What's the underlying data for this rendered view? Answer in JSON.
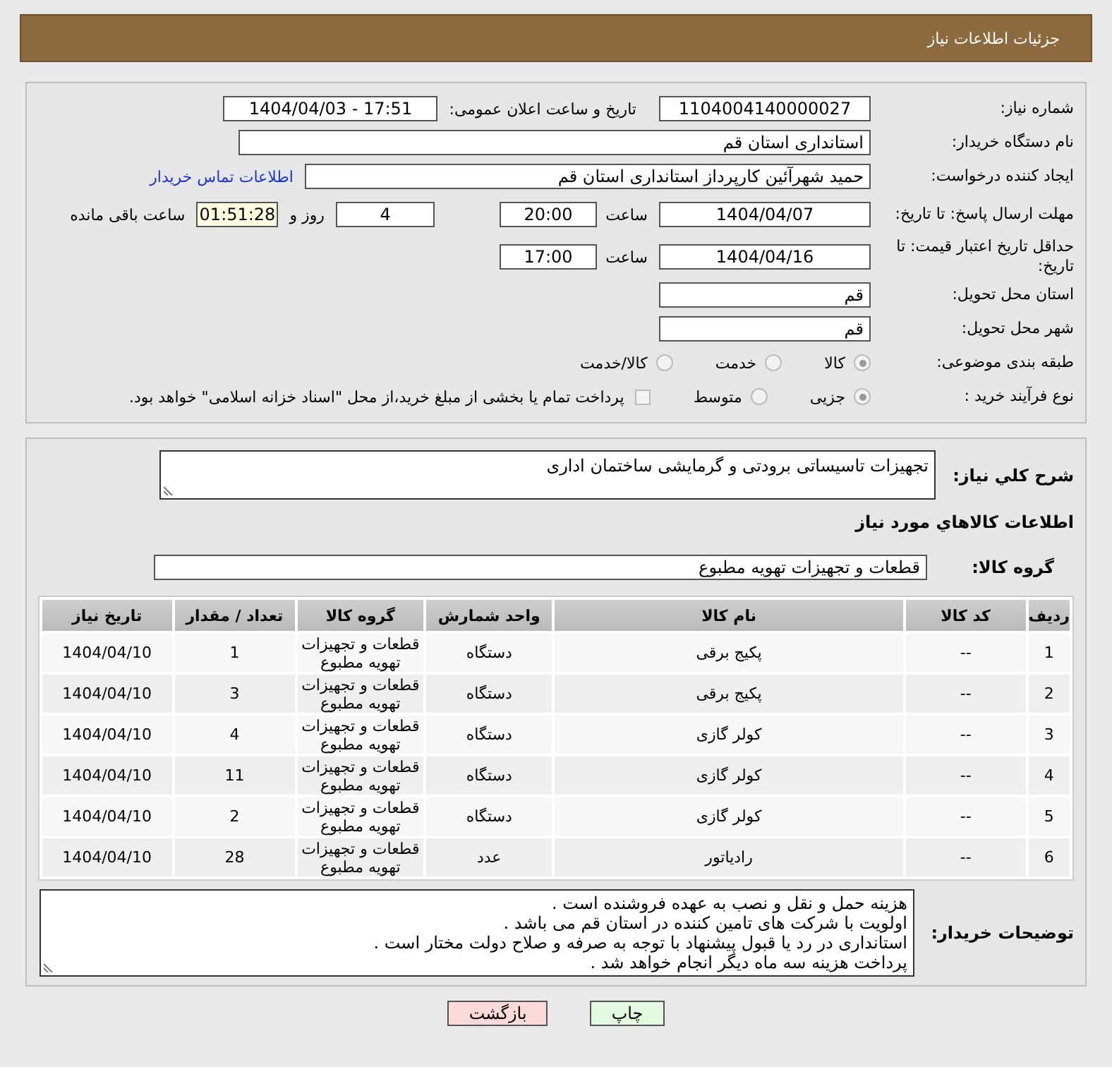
{
  "header": {
    "title": "جزئیات اطلاعات نیاز"
  },
  "need_number": {
    "label": "شماره نیاز:",
    "value": "1104004140000027"
  },
  "announce_datetime": {
    "label": "تاریخ و ساعت اعلان عمومی:",
    "value": "1404/04/03 - 17:51"
  },
  "buyer_org": {
    "label": "نام دستگاه خریدار:",
    "value": "استانداری استان قم"
  },
  "requester": {
    "label": "ایجاد کننده درخواست:",
    "value": "حمید شهرآئین کارپرداز استانداری استان قم",
    "contact_link": "اطلاعات تماس خریدار"
  },
  "response_deadline": {
    "label": "مهلت ارسال پاسخ: تا تاریخ:",
    "date": "1404/04/07",
    "time_label": "ساعت",
    "time": "20:00",
    "days": "4",
    "days_label": "روز و",
    "remaining": "01:51:28",
    "remaining_label": "ساعت باقی مانده"
  },
  "price_validity": {
    "label": "حداقل تاریخ اعتبار قیمت: تا تاریخ:",
    "date": "1404/04/16",
    "time_label": "ساعت",
    "time": "17:00"
  },
  "delivery_province": {
    "label": "استان محل تحویل:",
    "value": "قم"
  },
  "delivery_city": {
    "label": "شهر محل تحویل:",
    "value": "قم"
  },
  "category": {
    "label": "طبقه بندی موضوعی:",
    "options": [
      {
        "label": "کالا",
        "selected": true
      },
      {
        "label": "خدمت",
        "selected": false
      },
      {
        "label": "کالا/خدمت",
        "selected": false
      }
    ]
  },
  "purchase_type": {
    "label": "نوع فرآیند خرید :",
    "options": [
      {
        "label": "جزیی",
        "selected": true
      },
      {
        "label": "متوسط",
        "selected": false
      }
    ],
    "treasury": {
      "checked": false,
      "label": "پرداخت تمام یا بخشی از مبلغ خرید،از محل \"اسناد خزانه اسلامی\" خواهد بود."
    }
  },
  "description": {
    "label": "شرح کلي نیاز:",
    "value": "تجهیزات تاسیساتی برودتی و گرمایشی ساختمان اداری"
  },
  "goods_title": "اطلاعات کالاهاي مورد نياز",
  "goods_group": {
    "label": "گروه کالا:",
    "value": "قطعات و تجهیزات تهویه مطبوع"
  },
  "table": {
    "columns": [
      "ردیف",
      "کد کالا",
      "نام کالا",
      "واحد شمارش",
      "گروه کالا",
      "تعداد / مقدار",
      "تاریخ نیاز"
    ],
    "rows": [
      [
        "1",
        "--",
        "پکیج برقی",
        "دستگاه",
        "قطعات و تجهیزات تهویه مطبوع",
        "1",
        "1404/04/10"
      ],
      [
        "2",
        "--",
        "پکیج برقی",
        "دستگاه",
        "قطعات و تجهیزات تهویه مطبوع",
        "3",
        "1404/04/10"
      ],
      [
        "3",
        "--",
        "کولر گازی",
        "دستگاه",
        "قطعات و تجهیزات تهویه مطبوع",
        "4",
        "1404/04/10"
      ],
      [
        "4",
        "--",
        "کولر گازی",
        "دستگاه",
        "قطعات و تجهیزات تهویه مطبوع",
        "11",
        "1404/04/10"
      ],
      [
        "5",
        "--",
        "کولر گازی",
        "دستگاه",
        "قطعات و تجهیزات تهویه مطبوع",
        "2",
        "1404/04/10"
      ],
      [
        "6",
        "--",
        "رادیاتور",
        "عدد",
        "قطعات و تجهیزات تهویه مطبوع",
        "28",
        "1404/04/10"
      ]
    ]
  },
  "buyer_notes": {
    "label": "توضیحات خریدار:",
    "lines": [
      "هزینه حمل و نقل و نصب به عهده فروشنده است .",
      "اولویت با  شرکت های تامین کننده در استان قم می باشد .",
      "استانداری در رد یا قبول پیشنهاد با توجه به صرفه  و صلاح دولت مختار است .",
      "پرداخت هزینه سه ماه دیگر انجام خواهد شد ."
    ]
  },
  "buttons": [
    {
      "label": "چاپ",
      "kind": "print"
    },
    {
      "label": "بازگشت",
      "kind": "back"
    }
  ]
}
